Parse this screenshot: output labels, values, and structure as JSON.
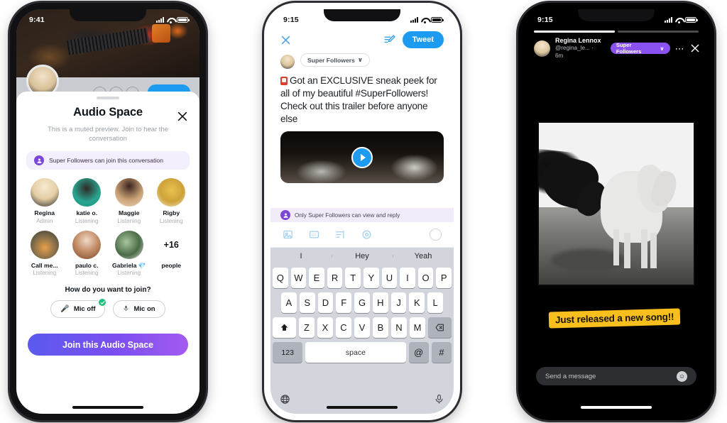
{
  "phone1": {
    "status": {
      "time": "9:41"
    },
    "profile_bg": {
      "follow_button_label": ""
    },
    "sheet": {
      "title": "Audio Space",
      "close_icon": "close-icon",
      "subtitle": "This is a muted preview. Join to hear the conversation",
      "super_followers_note": "Super Followers can join this conversation",
      "super_followers_badge_glyph": "•",
      "participants": [
        {
          "name": "Regina",
          "role": "Admin"
        },
        {
          "name": "katie o.",
          "role": "Listening"
        },
        {
          "name": "Maggie",
          "role": "Listening"
        },
        {
          "name": "Rigby",
          "role": "Listening"
        },
        {
          "name": "Call me...",
          "role": "Listening"
        },
        {
          "name": "paulo c.",
          "role": "Listening"
        },
        {
          "name": "Gabriela 💎",
          "role": "Listening"
        }
      ],
      "more_count": "+16",
      "more_label": "people",
      "join_question": "How do you want to join?",
      "mic_off_label": "Mic off",
      "mic_on_label": "Mic on",
      "mic_off_selected": true,
      "join_button_label": "Join this Audio Space"
    },
    "colors": {
      "accent_gradient_start": "#5b5bf0",
      "accent_gradient_end": "#a35bf0",
      "note_bg": "#f4effc",
      "badge_purple": "#7c46d6"
    }
  },
  "phone2": {
    "status": {
      "time": "9:15"
    },
    "compose": {
      "close_icon": "close-icon",
      "draft_icon": "draft-compose-icon",
      "tweet_button_label": "Tweet",
      "audience_chip_label": "Super Followers",
      "audience_chip_caret": "∨",
      "text": "Got an EXCLUSIVE sneak peek for all of my beautiful #SuperFollowers! Check out this trailer before anyone else",
      "media_play_icon": "play-icon",
      "restriction_note": "Only Super Followers can view and reply",
      "tools": [
        "image-icon",
        "gif-icon",
        "poll-icon",
        "location-icon"
      ],
      "char_counter_icon": "character-count-circle"
    },
    "keyboard": {
      "suggestions": [
        "I",
        "Hey",
        "Yeah"
      ],
      "row1": [
        "Q",
        "W",
        "E",
        "R",
        "T",
        "Y",
        "U",
        "I",
        "O",
        "P"
      ],
      "row2": [
        "A",
        "S",
        "D",
        "F",
        "G",
        "H",
        "J",
        "K",
        "L"
      ],
      "row3": [
        "Z",
        "X",
        "C",
        "V",
        "B",
        "N",
        "M"
      ],
      "shift_icon": "shift-icon",
      "backspace_icon": "backspace-icon",
      "numeric_key": "123",
      "space_key": "space",
      "at_key": "@",
      "hash_key": "#",
      "globe_icon": "globe-icon",
      "mic_icon": "microphone-icon"
    },
    "colors": {
      "twitter_blue": "#1d9bf0",
      "note_bg": "#f2ecfa",
      "keyboard_bg": "#d2d5db"
    }
  },
  "phone3": {
    "status": {
      "time": "9:15"
    },
    "story": {
      "progress_segments": 2,
      "active_segment_index": 0,
      "author_name": "Regina Lennox",
      "author_handle": "@regina_le... · 6m",
      "super_followers_pill": "Super Followers",
      "pill_caret": "∨",
      "more_icon": "more-options-icon",
      "close_icon": "close-icon",
      "sticker_text": "Just released a new song!!",
      "message_placeholder": "Send a message",
      "emoji_icon": "emoji-icon"
    },
    "colors": {
      "pill_purple": "#8a52f0",
      "sticker_yellow": "#f9bf1d",
      "message_bar": "#2c2e31"
    }
  }
}
